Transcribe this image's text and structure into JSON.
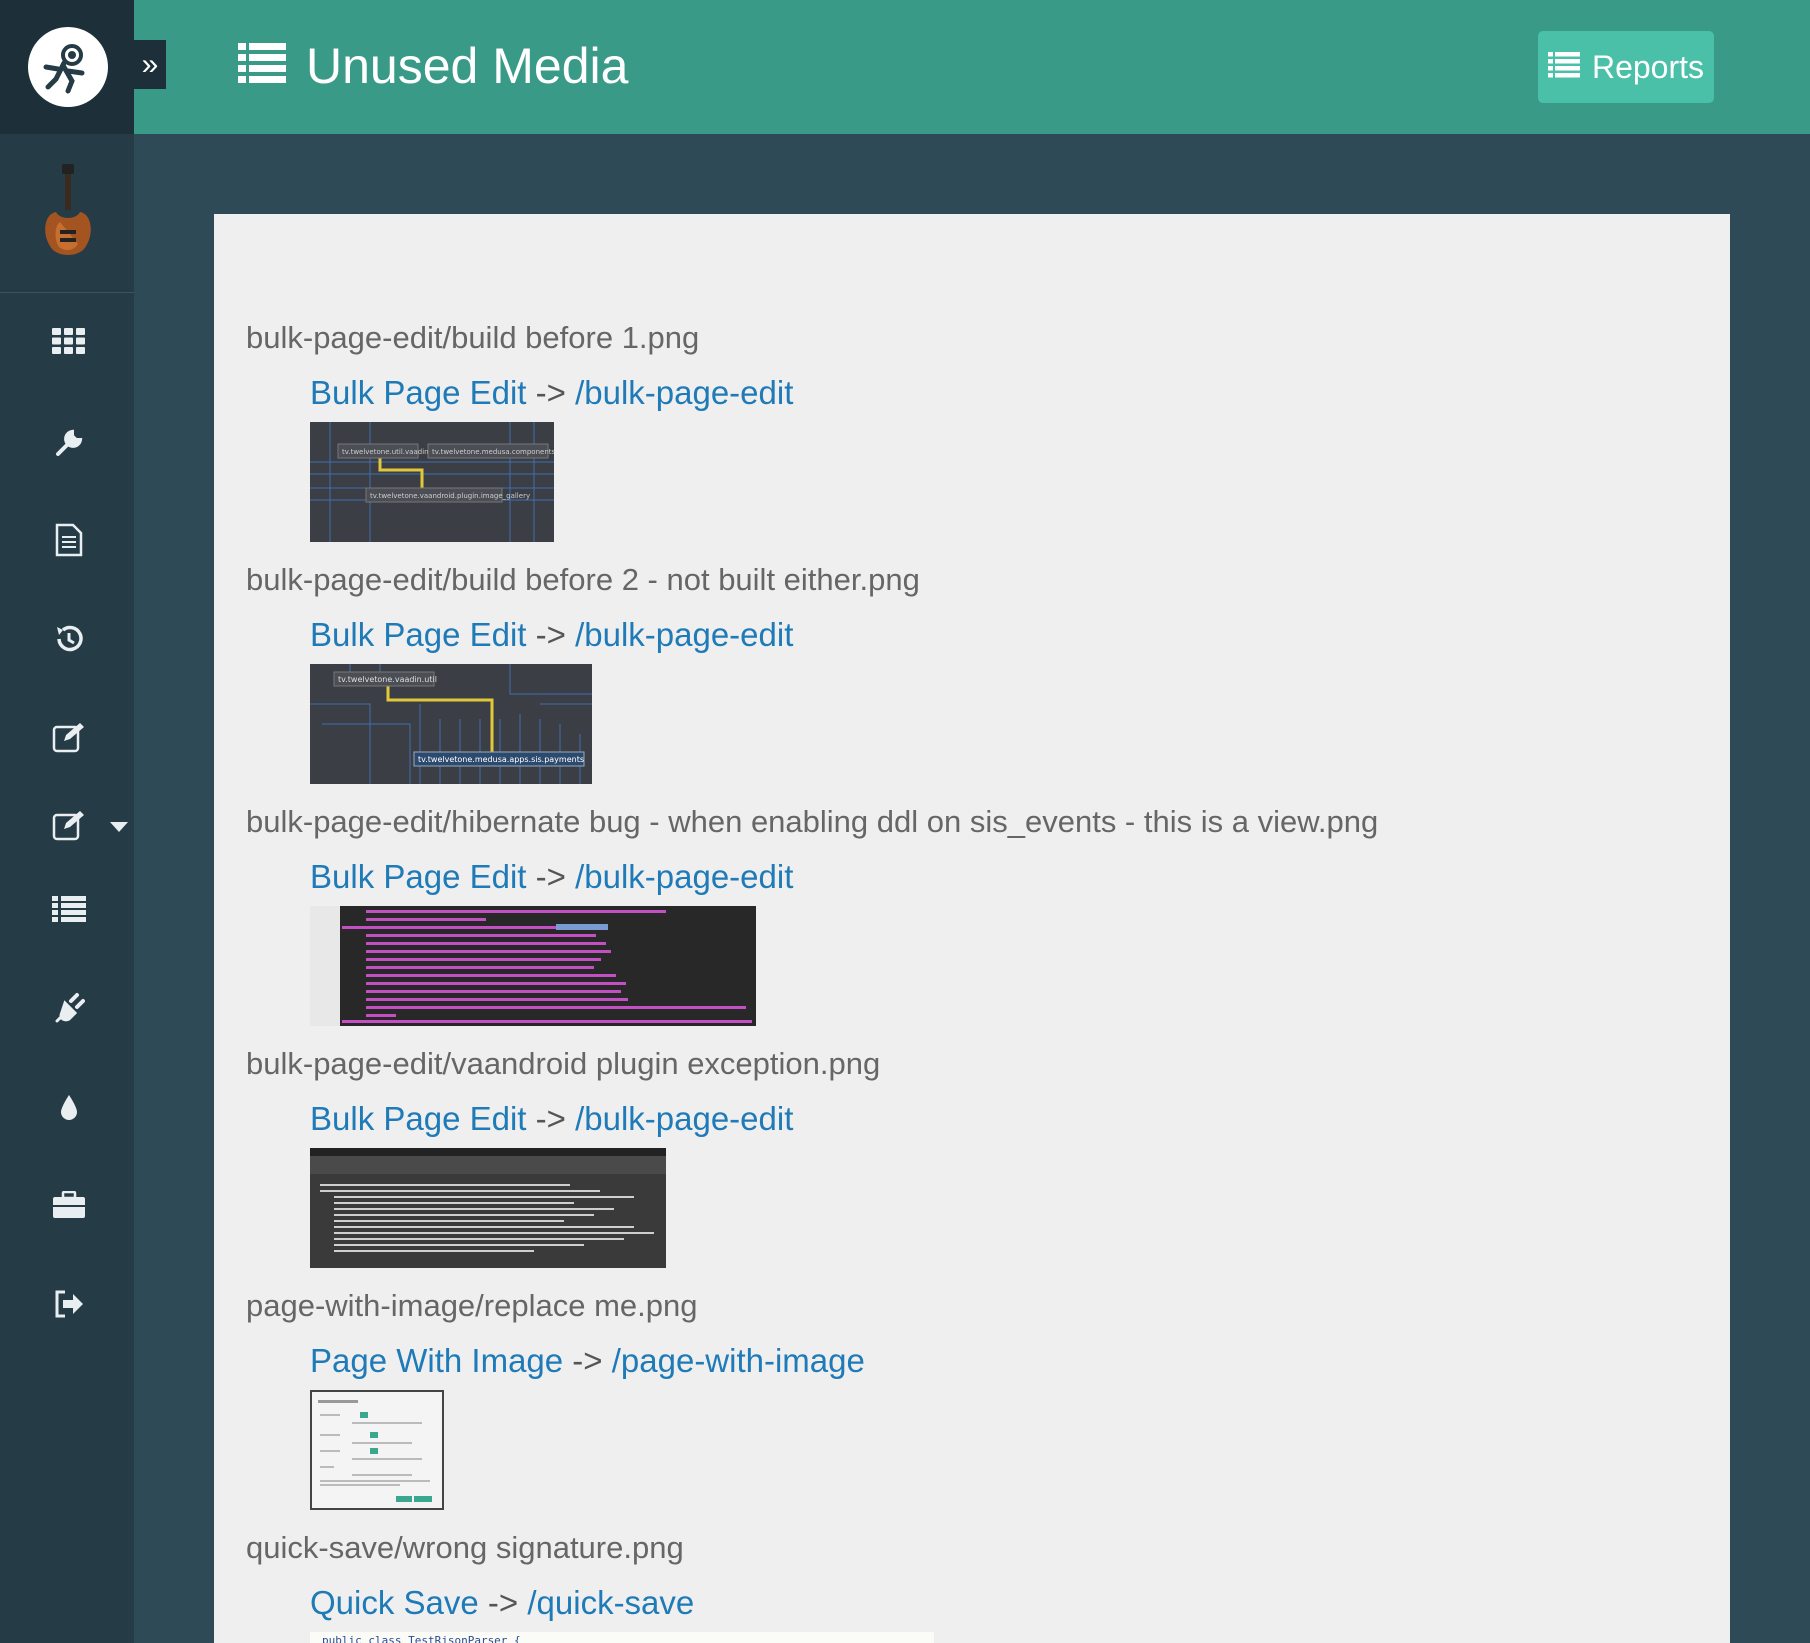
{
  "header": {
    "title": "Unused Media",
    "reports_label": "Reports"
  },
  "sidebar": {
    "items": [
      {
        "icon": "apps-grid-icon"
      },
      {
        "icon": "wrench-icon"
      },
      {
        "icon": "document-icon"
      },
      {
        "icon": "history-icon"
      },
      {
        "icon": "edit-icon"
      },
      {
        "icon": "edit-dropdown-icon"
      },
      {
        "icon": "list-icon"
      },
      {
        "icon": "plug-icon"
      },
      {
        "icon": "drop-icon"
      },
      {
        "icon": "briefcase-icon"
      },
      {
        "icon": "logout-icon"
      }
    ]
  },
  "media": [
    {
      "path": "bulk-page-edit/build before 1.png",
      "page_title": "Bulk Page Edit",
      "arrow": "->",
      "page_path": "/bulk-page-edit"
    },
    {
      "path": "bulk-page-edit/build before 2 - not built either.png",
      "page_title": "Bulk Page Edit",
      "arrow": "->",
      "page_path": "/bulk-page-edit"
    },
    {
      "path": "bulk-page-edit/hibernate bug - when enabling ddl on sis_events - this is a view.png",
      "page_title": "Bulk Page Edit",
      "arrow": "->",
      "page_path": "/bulk-page-edit"
    },
    {
      "path": "bulk-page-edit/vaandroid plugin exception.png",
      "page_title": "Bulk Page Edit",
      "arrow": "->",
      "page_path": "/bulk-page-edit"
    },
    {
      "path": "page-with-image/replace me.png",
      "page_title": "Page With Image",
      "arrow": "->",
      "page_path": "/page-with-image"
    },
    {
      "path": "quick-save/wrong signature.png",
      "page_title": "Quick Save",
      "arrow": "->",
      "page_path": "/quick-save"
    }
  ],
  "thumbnails": {
    "t1": {
      "label_a": "tv.twelvetone.util.vaadin",
      "label_b": "tv.twelvetone.medusa.components.mail",
      "label_c": "tv.twelvetone.vaandroid.plugin.image_gallery"
    },
    "t2": {
      "label_a": "tv.twelvetone.vaadin.util",
      "label_b": "tv.twelvetone.medusa.apps.sis.payments"
    },
    "t6": {
      "code": "public class TestRjsonParser {"
    }
  }
}
